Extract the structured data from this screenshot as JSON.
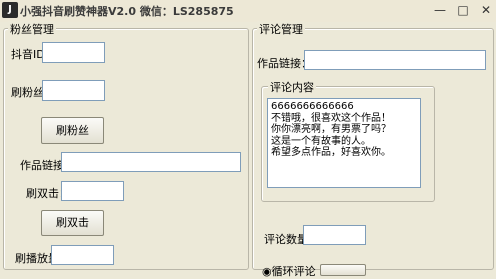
{
  "window": {
    "title": "小强抖音刷赞神器V2.0 微信：LS285875",
    "icon_glyph": "J",
    "controls": {
      "minimize": "—",
      "maximize": "□",
      "close": "✕"
    }
  },
  "fans_panel": {
    "title": "粉丝管理",
    "douyin_id_label": "抖音ID：",
    "douyin_id_value": "",
    "fans_count_label": "刷粉丝：",
    "fans_count_value": "",
    "fans_button": "刷粉丝",
    "works_link_label": "作品链接：",
    "works_link_value": "",
    "double_click_label": "刷双击：",
    "double_click_value": "",
    "double_click_button": "刷双击",
    "play_count_label": "刷播放量：",
    "play_count_value": ""
  },
  "comment_panel": {
    "title": "评论管理",
    "works_link_label": "作品链接：",
    "works_link_value": "",
    "content_group_title": "评论内容",
    "content_text": "6666666666666\n不错哦，很喜欢这个作品！\n你你漂亮啊，有男票了吗？\n这是一个有故事的人。\n希望多点作品，好喜欢你。",
    "count_label": "评论数量：",
    "count_value": "",
    "loop_radio_label": "◉循环评论"
  }
}
